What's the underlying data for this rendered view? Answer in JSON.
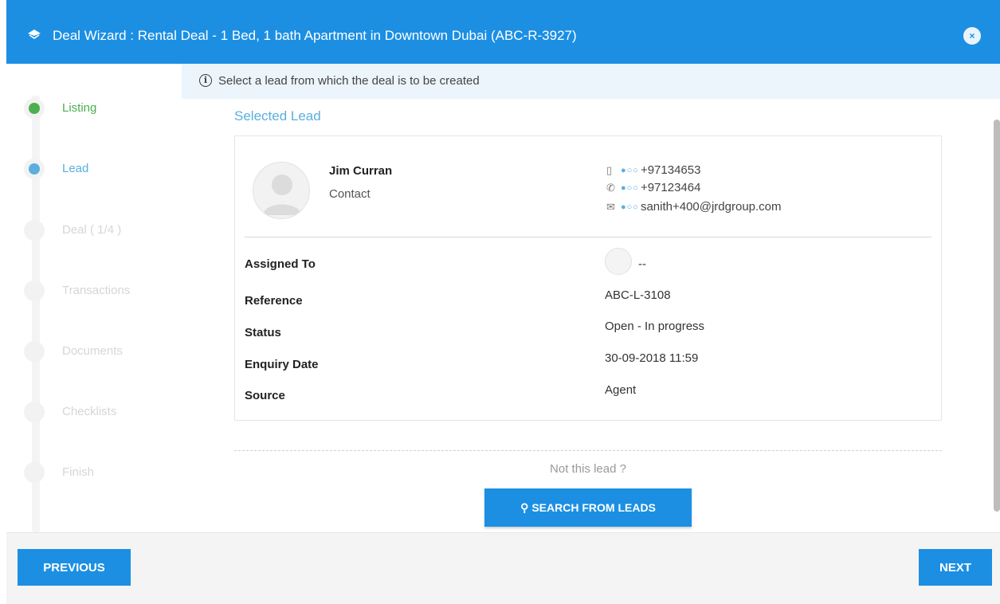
{
  "header": {
    "title": "Deal Wizard : Rental Deal - 1 Bed, 1 bath Apartment in Downtown Dubai (ABC-R-3927)",
    "close_label": "×"
  },
  "steps": [
    {
      "label": "Listing",
      "state": "done"
    },
    {
      "label": "Lead",
      "state": "active"
    },
    {
      "label": "Deal ( 1/4 )",
      "state": "todo"
    },
    {
      "label": "Transactions",
      "state": "todo"
    },
    {
      "label": "Documents",
      "state": "todo"
    },
    {
      "label": "Checklists",
      "state": "todo"
    },
    {
      "label": "Finish",
      "state": "todo"
    }
  ],
  "info": {
    "text": "Select a lead from which the deal is to be created"
  },
  "lead": {
    "section_title": "Selected Lead",
    "name": "Jim Curran",
    "type": "Contact",
    "mobile": "+97134653",
    "phone": "+97123464",
    "email": "sanith+400@jrdgroup.com",
    "assigned_to_label": "Assigned To",
    "assigned_to_value": "--",
    "reference_label": "Reference",
    "reference_value": "ABC-L-3108",
    "status_label": "Status",
    "status_value": "Open - In progress",
    "enquiry_date_label": "Enquiry Date",
    "enquiry_date_value": "30-09-2018 11:59",
    "source_label": "Source",
    "source_value": "Agent"
  },
  "not_this_lead": "Not this lead ?",
  "search_button_label": "SEARCH FROM LEADS",
  "footer": {
    "previous_label": "PREVIOUS",
    "next_label": "NEXT"
  },
  "colors": {
    "primary": "#1c8fe3",
    "done": "#4caf50",
    "active": "#5aaee0",
    "info_bg": "#ecf5fc"
  }
}
